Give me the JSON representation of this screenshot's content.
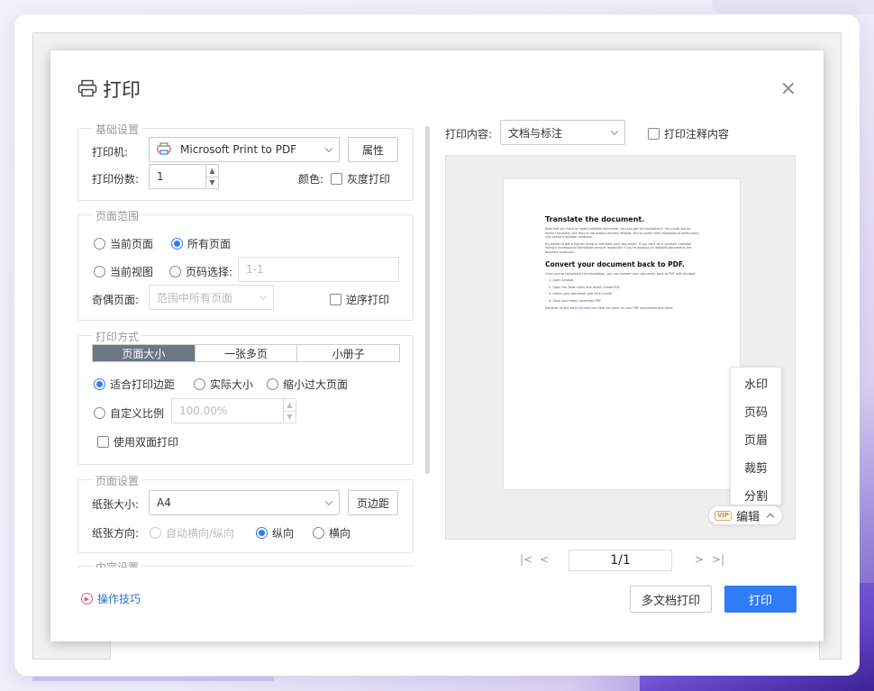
{
  "dialog": {
    "title": "打印",
    "close_glyph": "×",
    "tips_label": "操作技巧",
    "multi_doc_button": "多文档打印",
    "print_button": "打印"
  },
  "basic": {
    "group_title": "基础设置",
    "printer_label": "打印机:",
    "printer_value": "Microsoft Print to PDF",
    "properties_button": "属性",
    "copies_label": "打印份数:",
    "copies_value": "1",
    "color_label": "颜色:",
    "grayscale_label": "灰度打印"
  },
  "range": {
    "group_title": "页面范围",
    "current_page": "当前页面",
    "all_pages": "所有页面",
    "current_view": "当前视图",
    "page_select": "页码选择:",
    "page_select_placeholder": "1-1",
    "odd_even_label": "奇偶页面:",
    "odd_even_value": "范围中所有页面",
    "reverse_label": "逆序打印",
    "selected": "all_pages"
  },
  "mode": {
    "group_title": "打印方式",
    "tabs": [
      "页面大小",
      "一张多页",
      "小册子"
    ],
    "active_tab": 0,
    "fit_margins": "适合打印边距",
    "actual_size": "实际大小",
    "shrink_large": "缩小过大页面",
    "custom_scale": "自定义比例",
    "custom_scale_value": "100.00%",
    "duplex_label": "使用双面打印",
    "selected": "fit_margins"
  },
  "page_setup": {
    "group_title": "页面设置",
    "paper_size_label": "纸张大小:",
    "paper_size_value": "A4",
    "margins_button": "页边距",
    "orientation_label": "纸张方向:",
    "auto_orientation": "自动横向/纵向",
    "portrait": "纵向",
    "landscape": "横向",
    "selected": "portrait"
  },
  "content_setup": {
    "group_title": "内容设置"
  },
  "preview": {
    "content_label": "打印内容:",
    "content_value": "文档与标注",
    "annotations_label": "打印注释内容",
    "doc_heading_1": "Translate the document.",
    "doc_para_1": "Now that you have an easily editable document, you can get to translating it. You could use an online translator, but they're not always entirely reliable. You're surely seen examples of particularly silly online translator mistakes.",
    "doc_para_2": "It's better to get a human living or translate your document. If you can't do it yourself, consider hiring a professional translation service, especially if you're working on detailed documents like business contracts.",
    "doc_heading_2": "Convert your document back to PDF.",
    "doc_para_3": "Once you've completed the translation, you can convert your document back to PDF with Acrobat:",
    "doc_steps": [
      "1. Open Acrobat",
      "2. Open the Tools menu and select Create PDF",
      "3. Select your document and click Create",
      "4. Save your newly converted PDF"
    ],
    "doc_footer_pre": "Discover all the ways ",
    "doc_footer_link": "Acrobat",
    "doc_footer_post": " can help you work on your PDF documents and more.",
    "side_menu": [
      "水印",
      "页码",
      "页眉",
      "裁剪",
      "分割"
    ],
    "vip_badge": "VIP",
    "edit_label": "编辑",
    "page_indicator": "1/1"
  },
  "colors": {
    "accent": "#2f7cf6",
    "active_tab_bg": "#6d7886",
    "link": "#2f6fe0"
  }
}
